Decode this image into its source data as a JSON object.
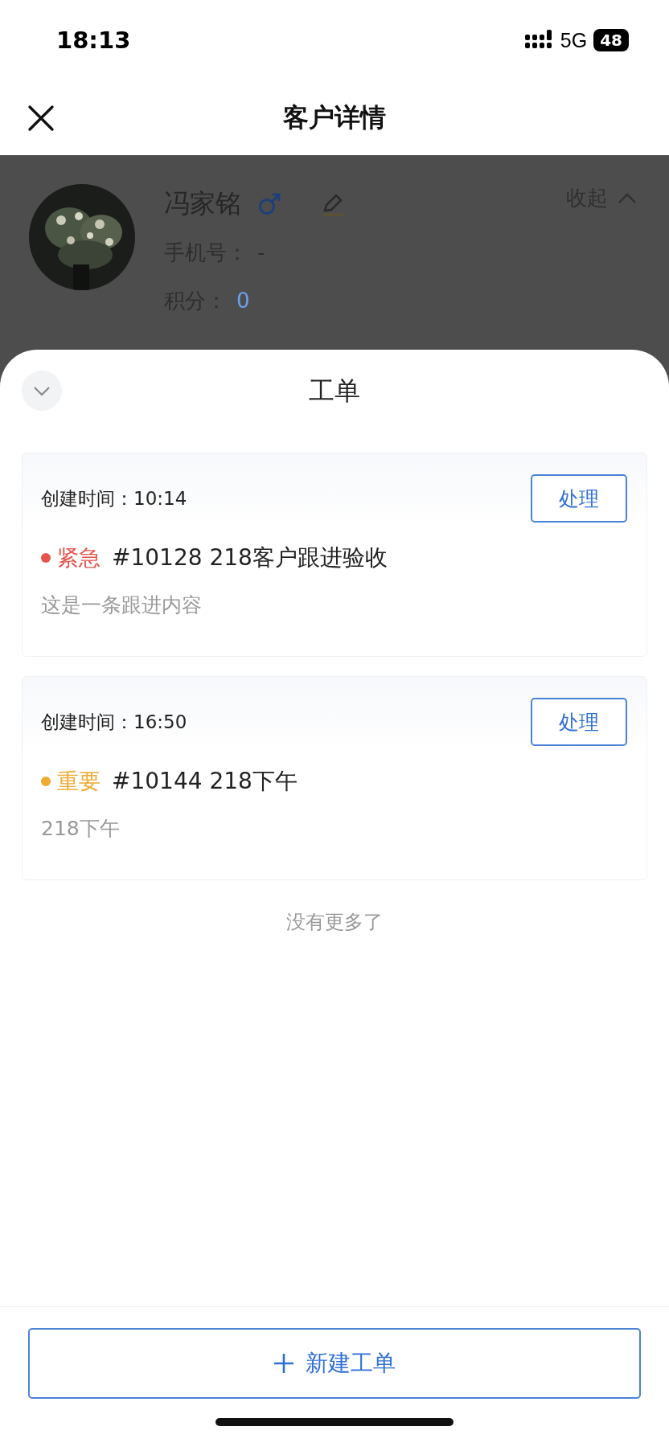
{
  "status_bar": {
    "time": "18:13",
    "network": "5G",
    "battery": "48"
  },
  "nav": {
    "title": "客户详情"
  },
  "customer": {
    "name": "冯家铭",
    "collapse": "收起",
    "fields": [
      {
        "label": "手机号：",
        "value": "-",
        "kind": "plain"
      },
      {
        "label": "积分：",
        "value": "0",
        "kind": "link"
      }
    ]
  },
  "sheet": {
    "title": "工单",
    "orders": [
      {
        "created_label": "创建时间：",
        "created_time": "10:14",
        "action": "处理",
        "priority": "紧急",
        "color": "#e5534b",
        "title": "#10128 218客户跟进验收",
        "content": "这是一条跟进内容"
      },
      {
        "created_label": "创建时间：",
        "created_time": "16:50",
        "action": "处理",
        "priority": "重要",
        "color": "#eeaa33",
        "title": "#10144 218下午",
        "content": "218下午"
      }
    ],
    "end_text": "没有更多了",
    "new_button": "新建工单"
  }
}
